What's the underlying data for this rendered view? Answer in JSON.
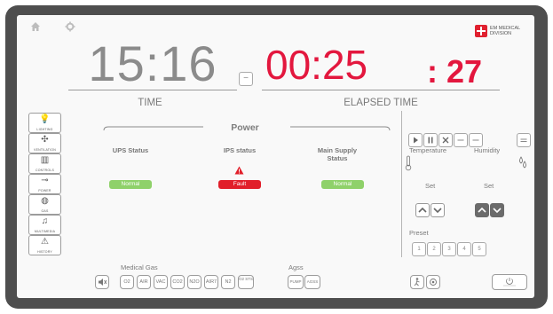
{
  "header": {
    "home_icon": "home-icon",
    "settings_icon": "gear-icon",
    "logo_line1": "EM MEDICAL",
    "logo_line2": "DIVISION"
  },
  "clock": {
    "time": "15:16",
    "time_label": "TIME",
    "reset_symbol": "−",
    "elapsed_main": "00:25",
    "elapsed_seconds": ": 27",
    "elapsed_label": "ELAPSED TIME"
  },
  "sidebar": {
    "items": [
      {
        "label": "LIGHTING",
        "icon": "lightbulb-icon",
        "glyph": "💡"
      },
      {
        "label": "VENTILATION",
        "icon": "fan-icon",
        "glyph": "✣"
      },
      {
        "label": "CONTROLS",
        "icon": "door-icon",
        "glyph": "▥"
      },
      {
        "label": "POWER",
        "icon": "plug-icon",
        "glyph": "⊸"
      },
      {
        "label": "GAS",
        "icon": "gas-icon",
        "glyph": "◍"
      },
      {
        "label": "MULTIMEDIA",
        "icon": "music-icon",
        "glyph": "♫"
      },
      {
        "label": "HISTORY",
        "icon": "warning-icon",
        "glyph": "⚠"
      }
    ]
  },
  "power": {
    "title": "Power",
    "ups": {
      "label": "UPS Status",
      "status": "Normal"
    },
    "ips": {
      "label": "IPS status",
      "status": "Fault"
    },
    "main": {
      "label": "Main Supply Status",
      "status": "Normal"
    },
    "colors": {
      "normal": "#8fd16a",
      "fault": "#e11f2a"
    }
  },
  "climate": {
    "temperature_label": "Temperature",
    "humidity_label": "Humidity",
    "set_label_left": "Set",
    "set_label_right": "Set",
    "preset_label": "Preset",
    "presets": [
      "1",
      "2",
      "3",
      "4",
      "5"
    ]
  },
  "gas": {
    "title": "Medical Gas",
    "buttons": [
      "O2",
      "AIR",
      "VAC",
      "CO2",
      "N2O",
      "AIR7",
      "N2",
      "O2 STS"
    ]
  },
  "agss": {
    "title": "Agss",
    "buttons": [
      "PUMP",
      "AGSS"
    ]
  }
}
